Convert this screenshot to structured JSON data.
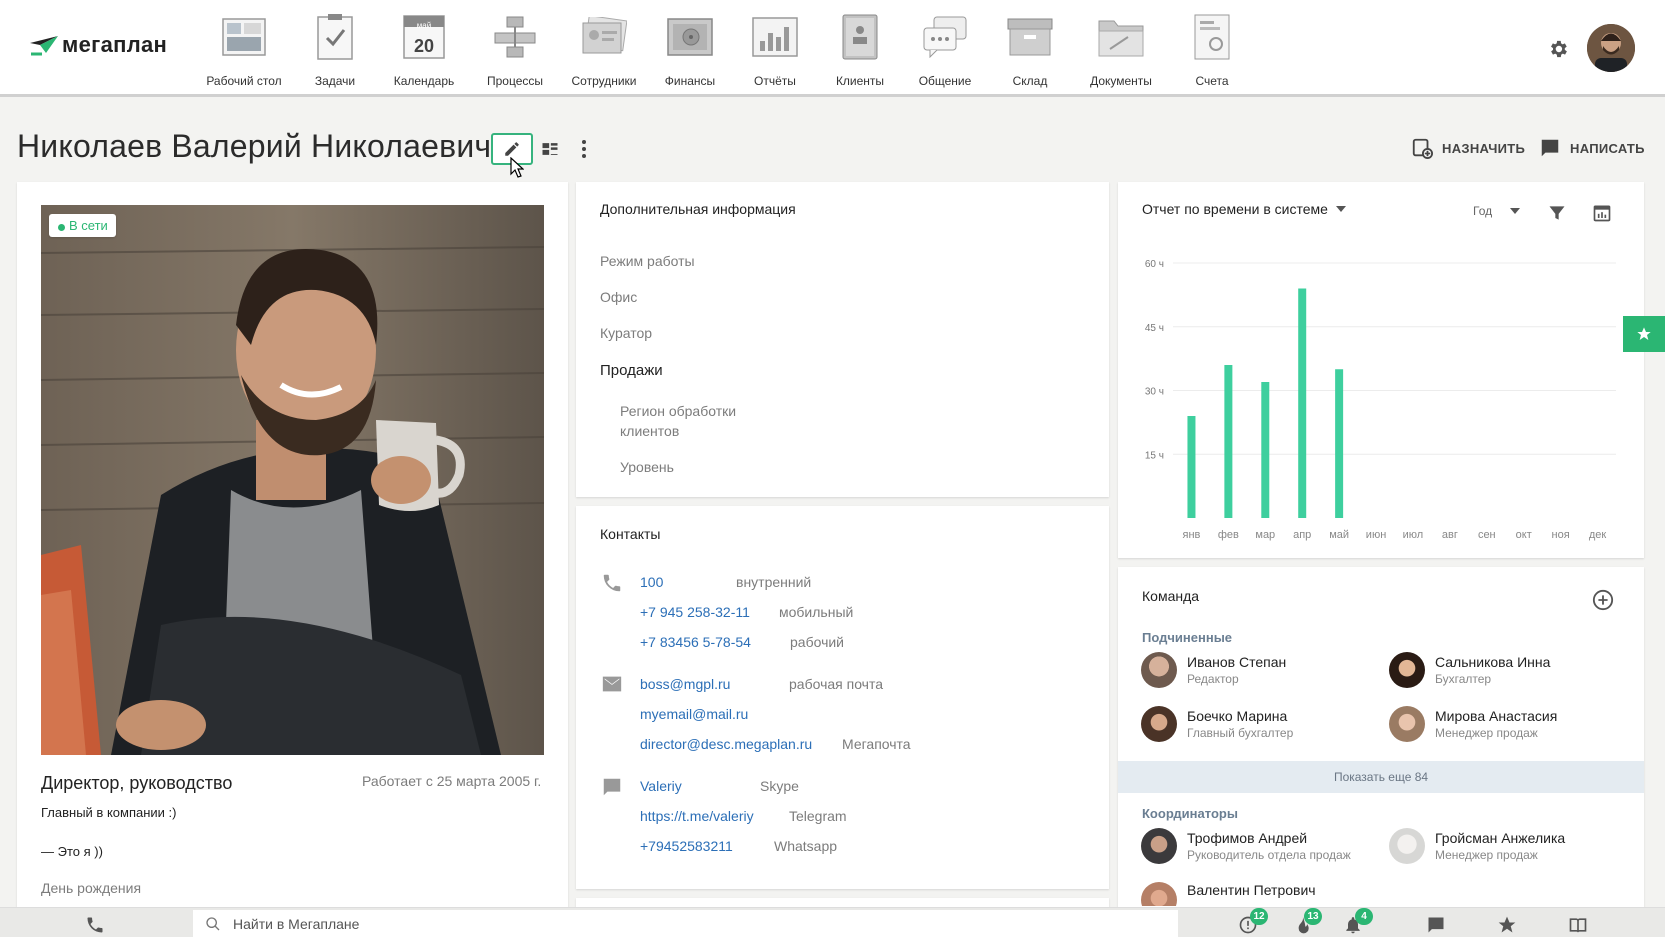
{
  "app": {
    "logo_text": "мегаплан"
  },
  "nav": [
    {
      "label": "Рабочий стол",
      "icon": "desktop-icon"
    },
    {
      "label": "Задачи",
      "icon": "tasks-icon"
    },
    {
      "label": "Календарь",
      "icon": "calendar-icon",
      "cal_month": "май",
      "cal_day": "20"
    },
    {
      "label": "Процессы",
      "icon": "processes-icon"
    },
    {
      "label": "Сотрудники",
      "icon": "employees-icon"
    },
    {
      "label": "Финансы",
      "icon": "finance-icon"
    },
    {
      "label": "Отчёты",
      "icon": "reports-icon"
    },
    {
      "label": "Клиенты",
      "icon": "clients-icon"
    },
    {
      "label": "Общение",
      "icon": "chat-icon"
    },
    {
      "label": "Склад",
      "icon": "warehouse-icon"
    },
    {
      "label": "Документы",
      "icon": "documents-icon"
    },
    {
      "label": "Счета",
      "icon": "invoices-icon"
    }
  ],
  "header": {
    "title": "Николаев Валерий Николаевич",
    "assign_label": "НАЗНАЧИТЬ",
    "write_label": "НАПИСАТЬ"
  },
  "profile": {
    "status": "В сети",
    "position": "Директор, руководство",
    "works_since": "Работает с 25 марта 2005 г.",
    "about_line1": "Главный в компании :)",
    "about_line2": "— Это я ))",
    "birthday_label": "День рождения"
  },
  "additional": {
    "title": "Дополнительная информация",
    "work_mode": "Режим работы",
    "office": "Офис",
    "curator": "Куратор",
    "sales_section": "Продажи",
    "region_line1": "Регион обработки",
    "region_line2": "клиентов",
    "level": "Уровень"
  },
  "contacts": {
    "title": "Контакты",
    "phones": [
      {
        "value": "100",
        "type": "внутренний"
      },
      {
        "value": "+7 945 258-32-11",
        "type": "мобильный"
      },
      {
        "value": "+7 83456 5-78-54",
        "type": "рабочий"
      }
    ],
    "emails": [
      {
        "value": "boss@mgpl.ru",
        "type": "рабочая почта"
      },
      {
        "value": "myemail@mail.ru",
        "type": ""
      },
      {
        "value": "director@desc.megaplan.ru",
        "type": "Мегапочта"
      }
    ],
    "messengers": [
      {
        "value": "Valeriy",
        "type": "Skype"
      },
      {
        "value": "https://t.me/valeriy",
        "type": "Telegram"
      },
      {
        "value": "+79452583211",
        "type": "Whatsapp"
      }
    ]
  },
  "report": {
    "title": "Отчет по времени в системе",
    "period": "Год"
  },
  "chart_data": {
    "type": "bar",
    "categories": [
      "янв",
      "фев",
      "мар",
      "апр",
      "май",
      "июн",
      "июл",
      "авг",
      "сен",
      "окт",
      "ноя",
      "дек"
    ],
    "values": [
      24,
      36,
      32,
      54,
      35,
      0,
      0,
      0,
      0,
      0,
      0,
      0
    ],
    "y_ticks": [
      "15 ч",
      "30 ч",
      "45 ч",
      "60 ч"
    ],
    "ylim": [
      0,
      60
    ],
    "color": "#3ecf9e",
    "grid": true
  },
  "team": {
    "title": "Команда",
    "subordinates_label": "Подчиненные",
    "subordinates": [
      {
        "name": "Иванов Степан",
        "role": "Редактор"
      },
      {
        "name": "Сальникова Инна",
        "role": "Бухгалтер"
      },
      {
        "name": "Боечко Марина",
        "role": "Главный бухгалтер"
      },
      {
        "name": "Мирова Анастасия",
        "role": "Менеджер продаж"
      }
    ],
    "show_more": "Показать еще 84",
    "coordinators_label": "Координаторы",
    "coordinators": [
      {
        "name": "Трофимов Андрей",
        "role": "Руководитель отдела продаж"
      },
      {
        "name": "Гройсман Анжелика",
        "role": "Менеджер продаж"
      },
      {
        "name": "Валентин Петрович",
        "role": ""
      }
    ]
  },
  "bottombar": {
    "search_placeholder": "Найти в Мегаплане",
    "badge_tasks": "12",
    "badge_hot": "13",
    "badge_notifications": "4"
  }
}
